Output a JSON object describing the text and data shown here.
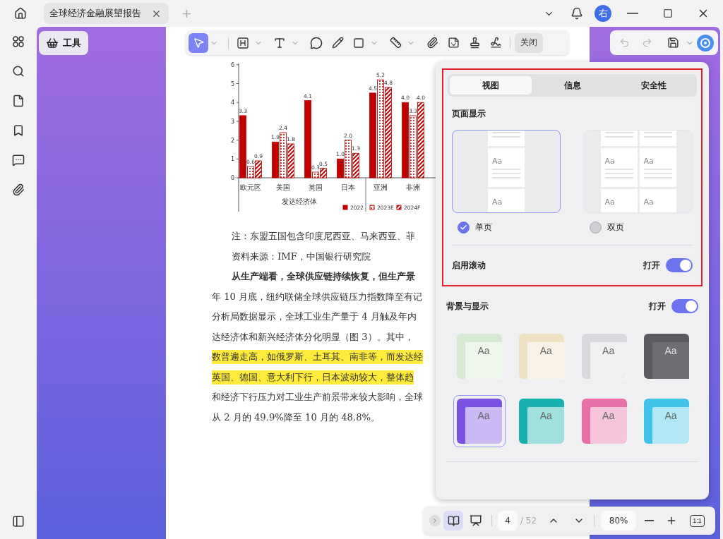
{
  "tab": {
    "title": "全球经济金融展望报告"
  },
  "avatar": {
    "initial": "右"
  },
  "tools_button": {
    "label": "工具"
  },
  "toolbar": {
    "close_label": "关闭"
  },
  "chart_data": {
    "type": "bar",
    "categories": [
      "欧元区",
      "美国",
      "英国",
      "日本",
      "亚洲",
      "非洲"
    ],
    "annotations": [
      {
        "text": "发达经济体"
      }
    ],
    "yticks": [
      0,
      1,
      2,
      3,
      4,
      5,
      6
    ],
    "ylim": [
      0,
      6
    ],
    "legend": true,
    "series": [
      {
        "name": "2022",
        "color": "#c00000",
        "values": [
          3.3,
          1.9,
          4.1,
          1.0,
          4.5,
          4.0
        ]
      },
      {
        "name": "2023E",
        "color": "#c00000",
        "values": [
          0.6,
          2.4,
          0.3,
          2.0,
          5.2,
          3.3
        ]
      },
      {
        "name": "2024F",
        "color": "#c00000",
        "values": [
          0.9,
          1.8,
          0.5,
          1.3,
          4.8,
          4.0
        ]
      }
    ],
    "value_labels": [
      [
        "3.3",
        "1.9",
        "4.1",
        "1.0",
        "4.5",
        "4.0"
      ],
      [
        "0.6",
        "2.4",
        "0.3",
        "2.0",
        "5.2",
        "3.3"
      ],
      [
        "0.9",
        "1.8",
        "0.5",
        "1.3",
        "4.8",
        "4.0"
      ]
    ]
  },
  "document_lines": [
    {
      "text": "注：东盟五国包含印度尼西亚、马来西亚、菲",
      "kind": "note",
      "highlighted": false
    },
    {
      "text": "资料来源：IMF，中国银行研究院",
      "kind": "note",
      "highlighted": false
    },
    {
      "text": "从生产端看，全球供应链持续恢复，但生产景",
      "kind": "heading",
      "highlighted": false
    },
    {
      "text": "年 10 月底，纽约联储全球供应链压力指数降至有记",
      "kind": "body",
      "highlighted": false
    },
    {
      "text": "分析局数据显示，全球工业生产量于 4 月触及年内",
      "kind": "body",
      "highlighted": false
    },
    {
      "text": "达经济体和新兴经济体分化明显（图 3）。其中，",
      "kind": "body",
      "highlighted": false
    },
    {
      "text": "数普遍走高，如俄罗斯、土耳其、南非等，而发达经",
      "kind": "body",
      "highlighted": true
    },
    {
      "text": "英国、德国、意大利下行，日本波动较大，整体趋",
      "kind": "body",
      "highlighted": true
    },
    {
      "text": "和经济下行压力对工业生产前景带来较大影响，全球",
      "kind": "body",
      "highlighted": false
    },
    {
      "text": "从 2 月的 49.9%降至 10 月的 48.8%。",
      "kind": "body",
      "highlighted": false
    }
  ],
  "panel": {
    "tabs": [
      {
        "label": "视图",
        "selected": true
      },
      {
        "label": "信息",
        "selected": false
      },
      {
        "label": "安全性",
        "selected": false
      }
    ],
    "page_display": {
      "title": "页面显示",
      "options": [
        {
          "label": "单页",
          "kind": "single",
          "selected": true,
          "preview_texts": [
            "Aa",
            "Aa"
          ]
        },
        {
          "label": "双页",
          "kind": "double",
          "selected": false,
          "preview_texts": [
            "Aa",
            "Aa",
            "Aa",
            "Aa"
          ]
        }
      ]
    },
    "scroll": {
      "label": "启用滚动",
      "state_label": "打开",
      "on": true
    },
    "background": {
      "label": "背景与显示",
      "state_label": "打开",
      "on": true
    },
    "themes": [
      {
        "color": "#d6ead3",
        "sample": "Aa",
        "selected": false
      },
      {
        "color": "#efe2c2",
        "sample": "Aa",
        "selected": false
      },
      {
        "color": "#d9d9dd",
        "sample": "Aa",
        "selected": false
      },
      {
        "color": "#5b5b60",
        "sample": "Aa",
        "selected": false
      },
      {
        "color": "#7b52e0",
        "sample": "Aa",
        "selected": true
      },
      {
        "color": "#17b2b0",
        "sample": "Aa",
        "selected": false
      },
      {
        "color": "#e86fa8",
        "sample": "Aa",
        "selected": false
      },
      {
        "color": "#3fc3e8",
        "sample": "Aa",
        "selected": false
      }
    ]
  },
  "bottom_bar": {
    "page": "4",
    "total": "/ 52",
    "zoom": "80%",
    "fit_label": "1:1"
  }
}
